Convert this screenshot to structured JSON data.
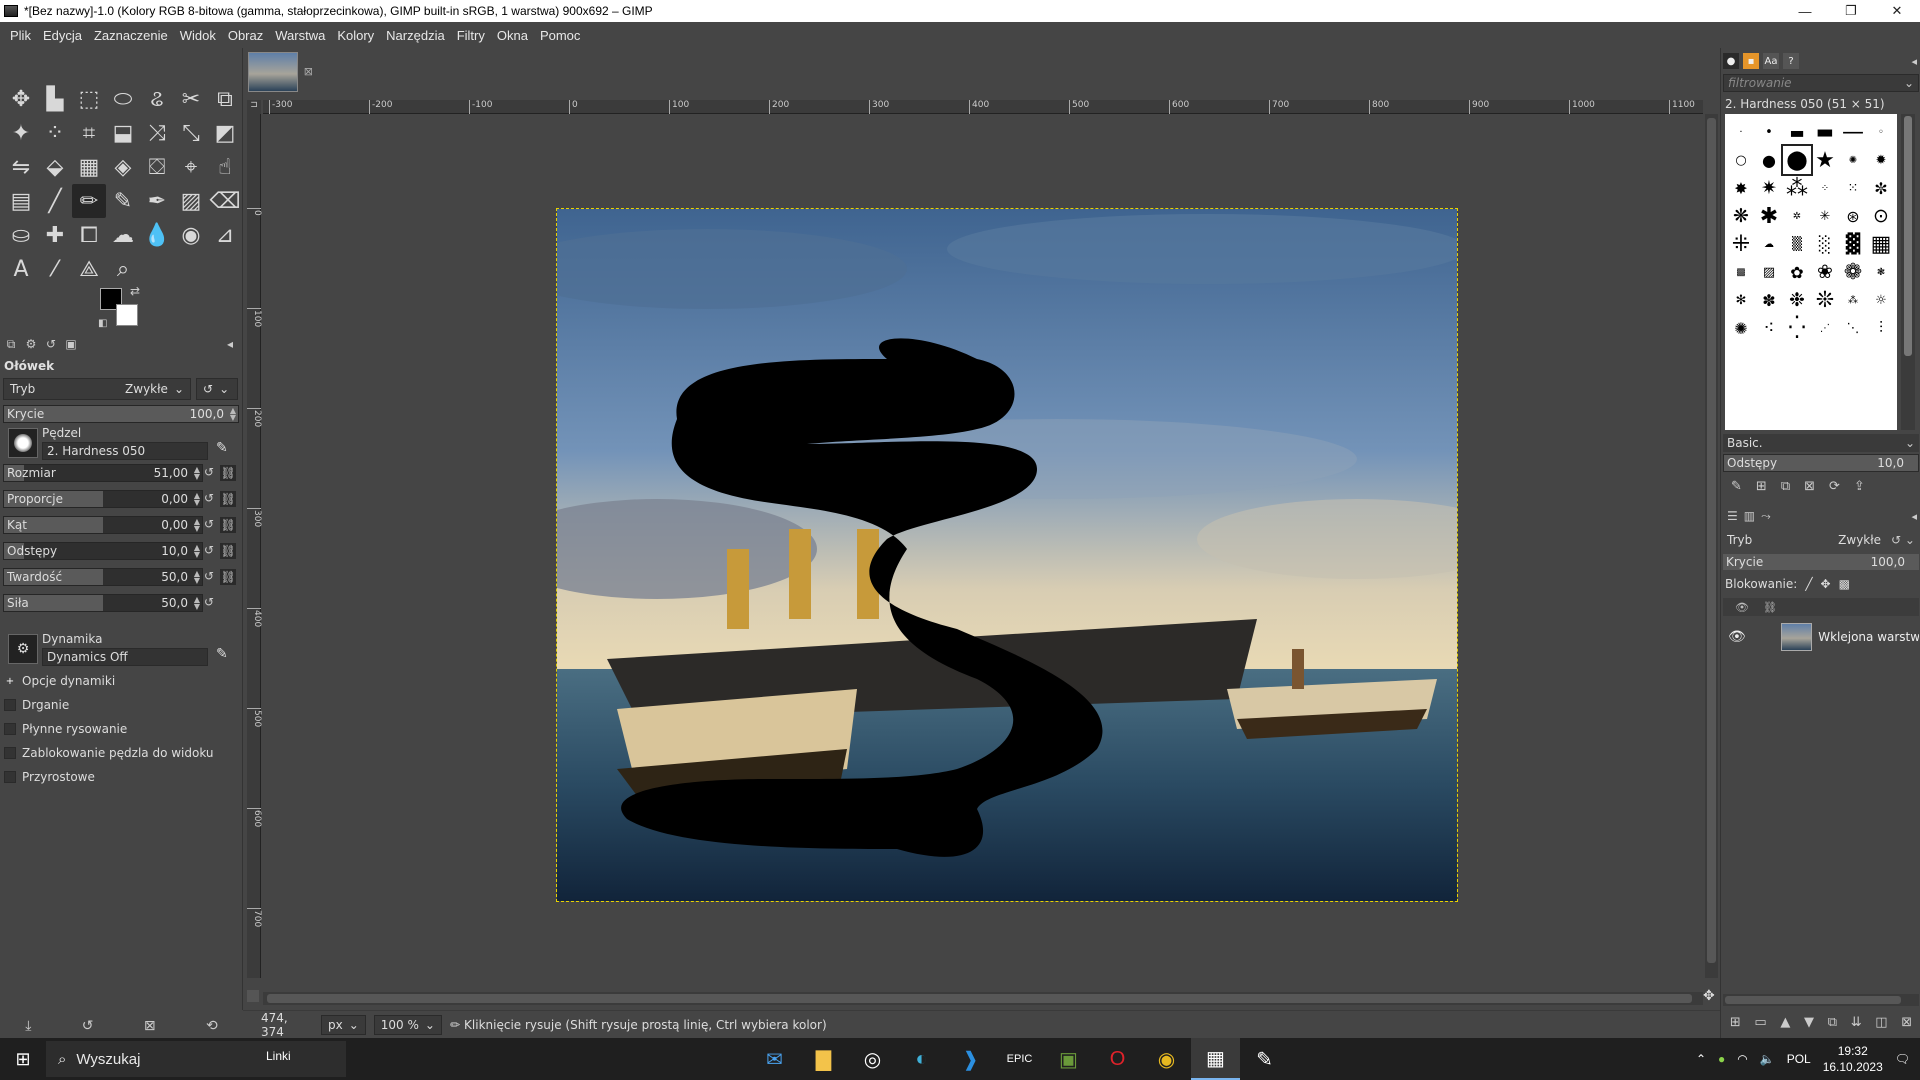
{
  "window": {
    "title": "*[Bez nazwy]-1.0 (Kolory RGB 8-bitowa (gamma, stałoprzecinkowa), GIMP built-in sRGB, 1 warstwa) 900x692 – GIMP",
    "minimize": "—",
    "maximize": "❐",
    "close": "✕"
  },
  "menu": [
    "Plik",
    "Edycja",
    "Zaznaczenie",
    "Widok",
    "Obraz",
    "Warstwa",
    "Kolory",
    "Narzędzia",
    "Filtry",
    "Okna",
    "Pomoc"
  ],
  "tools": [
    {
      "name": "move-tool-icon",
      "glyph": "✥"
    },
    {
      "name": "align-tool-icon",
      "glyph": "▙"
    },
    {
      "name": "rect-select-icon",
      "glyph": "⬚"
    },
    {
      "name": "ellipse-select-icon",
      "glyph": "⬭"
    },
    {
      "name": "free-select-icon",
      "glyph": "ଌ"
    },
    {
      "name": "scissors-icon",
      "glyph": "✂"
    },
    {
      "name": "foreground-select-icon",
      "glyph": "⧉"
    },
    {
      "name": "fuzzy-select-icon",
      "glyph": "✦"
    },
    {
      "name": "color-select-icon",
      "glyph": "⁘"
    },
    {
      "name": "crop-icon",
      "glyph": "⌗"
    },
    {
      "name": "unified-transform-icon",
      "glyph": "⬓"
    },
    {
      "name": "warp-icon",
      "glyph": "⤨"
    },
    {
      "name": "scale-icon",
      "glyph": "⤡"
    },
    {
      "name": "shear-icon",
      "glyph": "◩"
    },
    {
      "name": "flip-icon",
      "glyph": "⇋"
    },
    {
      "name": "perspective-icon",
      "glyph": "⬙"
    },
    {
      "name": "cage-icon",
      "glyph": "▦"
    },
    {
      "name": "paint-select-icon",
      "glyph": "◈"
    },
    {
      "name": "bucket-fill-icon",
      "glyph": "⛋"
    },
    {
      "name": "path-icon",
      "glyph": "⌖"
    },
    {
      "name": "smudge-icon",
      "glyph": "☝"
    },
    {
      "name": "gradient-icon",
      "glyph": "▤"
    },
    {
      "name": "paintbrush-icon",
      "glyph": "╱"
    },
    {
      "name": "pencil-icon",
      "glyph": "✏"
    },
    {
      "name": "airbrush-icon",
      "glyph": "✎"
    },
    {
      "name": "ink-icon",
      "glyph": "✒"
    },
    {
      "name": "mypaint-brush-icon",
      "glyph": "▨"
    },
    {
      "name": "eraser-icon",
      "glyph": "⌫"
    },
    {
      "name": "clone-icon",
      "glyph": "⛀"
    },
    {
      "name": "heal-icon",
      "glyph": "✚"
    },
    {
      "name": "perspective-clone-icon",
      "glyph": "⧠"
    },
    {
      "name": "blur-icon",
      "glyph": "☁"
    },
    {
      "name": "dodge-icon",
      "glyph": "💧"
    },
    {
      "name": "burn-icon",
      "glyph": "◉"
    },
    {
      "name": "measure-icon",
      "glyph": "⊿"
    },
    {
      "name": "text-tool-icon",
      "glyph": "A"
    },
    {
      "name": "color-picker-icon",
      "glyph": "⁄"
    },
    {
      "name": "measure-tool-icon",
      "glyph": "⟁"
    },
    {
      "name": "zoom-tool-icon",
      "glyph": "⌕"
    }
  ],
  "tool_options": {
    "title": "Ołówek",
    "mode_label": "Tryb",
    "mode_value": "Zwykłe",
    "opacity_label": "Krycie",
    "opacity_value": "100,0",
    "opacity_fraction": 1.0,
    "brush_caption": "Pędzel",
    "brush_value": "2. Hardness 050",
    "sliders": [
      {
        "label": "Rozmiar",
        "value": "51,00",
        "fraction": 0.1
      },
      {
        "label": "Proporcje",
        "value": "0,00",
        "fraction": 0.5
      },
      {
        "label": "Kąt",
        "value": "0,00",
        "fraction": 0.5
      },
      {
        "label": "Odstępy",
        "value": "10,0",
        "fraction": 0.1
      },
      {
        "label": "Twardość",
        "value": "50,0",
        "fraction": 0.5
      },
      {
        "label": "Siła",
        "value": "50,0",
        "fraction": 0.5
      }
    ],
    "dynamics_caption": "Dynamika",
    "dynamics_value": "Dynamics Off",
    "checks": [
      {
        "label": "Opcje dynamiki",
        "expander": true
      },
      {
        "label": "Drganie",
        "checked": false
      },
      {
        "label": "Płynne rysowanie",
        "checked": false
      },
      {
        "label": "Zablokowanie pędzla do widoku",
        "checked": false
      },
      {
        "label": "Przyrostowe",
        "checked": false
      }
    ]
  },
  "rulers": {
    "top": [
      "-300",
      "-200",
      "-100",
      "0",
      "100",
      "200",
      "300",
      "400",
      "500",
      "600",
      "700",
      "800",
      "900",
      "1000",
      "1100"
    ],
    "left": [
      "0",
      "100",
      "200",
      "300",
      "400",
      "500",
      "600",
      "700"
    ]
  },
  "status": {
    "coords": "474, 374",
    "unit": "px",
    "zoom": "100 %",
    "message": "Kliknięcie rysuje (Shift rysuje prostą linię, Ctrl wybiera kolor)"
  },
  "brushes_panel": {
    "filter_placeholder": "filtrowanie",
    "brush_info": "2. Hardness 050 (51 × 51)",
    "preset": "Basic.",
    "spacing_label": "Odstępy",
    "spacing_value": "10,0"
  },
  "layers_panel": {
    "mode_label": "Tryb",
    "mode_value": "Zwykłe",
    "opacity_label": "Krycie",
    "opacity_value": "100,0",
    "lock_label": "Blokowanie:",
    "layer_name": "Wklejona warstwa"
  },
  "taskbar": {
    "search_label": "Wyszukaj",
    "news_label": "Linki",
    "lang": "POL",
    "time": "19:32",
    "date": "16.10.2023"
  }
}
